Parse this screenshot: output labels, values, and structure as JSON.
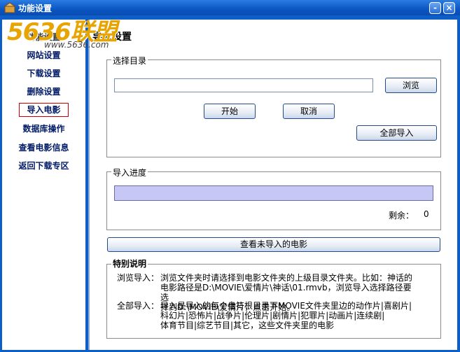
{
  "window": {
    "title": "功能设置",
    "minimize_glyph": "-",
    "close_glyph": "×"
  },
  "watermark": {
    "big": "5636联盟",
    "url": "www.5636.com"
  },
  "sidebar": {
    "header": "功能设置",
    "items": [
      {
        "label": "网站设置"
      },
      {
        "label": "下载设置"
      },
      {
        "label": "删除设置"
      },
      {
        "label": "导入电影",
        "active": true
      },
      {
        "label": "数据库操作"
      },
      {
        "label": "查看电影信息"
      },
      {
        "label": "返回下载专区"
      }
    ]
  },
  "main": {
    "title": "导入设置",
    "select_dir": {
      "legend": "选择目录",
      "path_value": "",
      "browse_label": "浏览",
      "start_label": "开始",
      "cancel_label": "取消",
      "import_all_label": "全部导入"
    },
    "progress": {
      "legend": "导入进度",
      "remaining_label": "剩余：",
      "remaining_value": "0"
    },
    "view_unimported_label": "查看未导入的电影",
    "notes": {
      "legend": "特别说明",
      "browse_label": "浏览导入：",
      "browse_lines": [
        "浏览文件夹时请选择到电影文件夹的上级目录文件夹。比如：神话的",
        "电影路径是D:\\MOVIE\\爱情片\\神话\\01.rmvb，浏览导入选择路径要选",
        "择到D:\\MOVIE\\爱情片，点击开始。"
      ],
      "all_label": "全部导入：",
      "all_lines": [
        "导入是导入的每个盘符根目录下MOVIE文件夹里边的动作片|喜剧片|",
        "科幻片|恐怖片|战争片|伦理片|剧情片|犯罪片|动画片|连续剧|",
        "体育节目|综艺节目|其它，这些文件夹里的电影"
      ]
    }
  },
  "colors": {
    "titlebar": "#0a56c2",
    "frame": "#0d5ec7",
    "watermark_primary": "#e8a400",
    "watermark_secondary": "#2a4fb0",
    "progress_fill": "#c7c7f5"
  }
}
